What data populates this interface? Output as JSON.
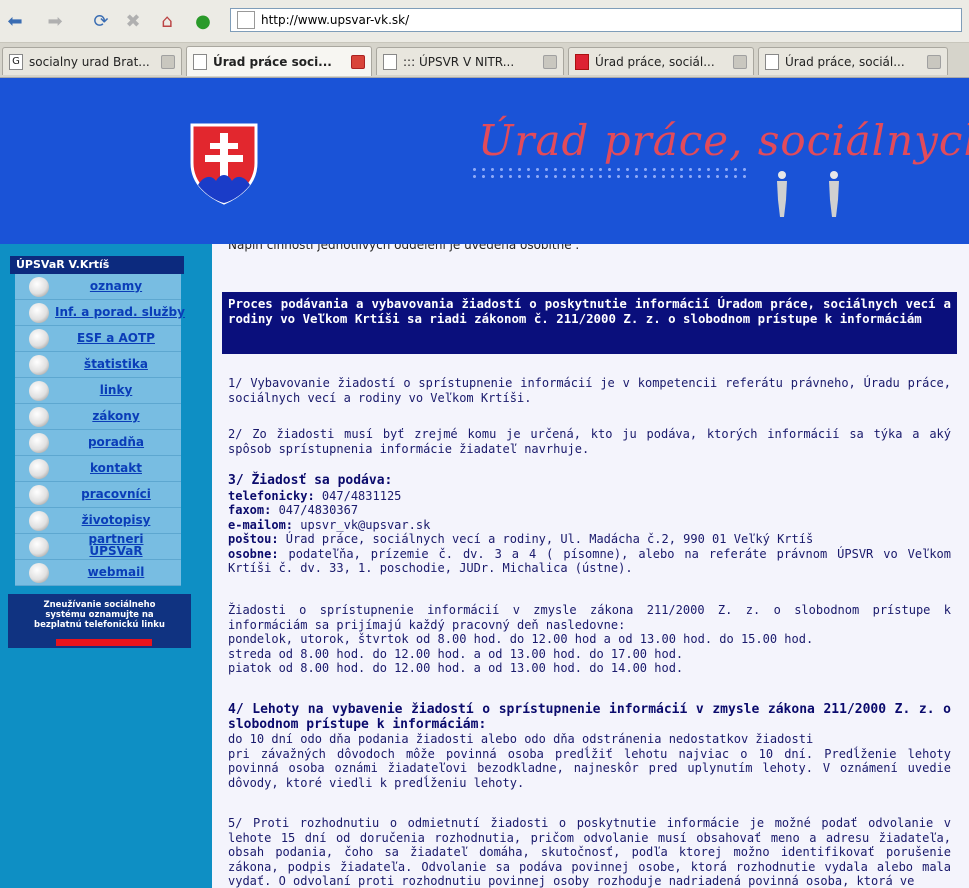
{
  "browser": {
    "address": "http://www.upsvar-vk.sk/",
    "tabs": [
      {
        "label": "socialny urad Brat...",
        "icon": "google-icon",
        "active": false
      },
      {
        "label": "Úrad práce soci...",
        "icon": "page-icon",
        "active": true
      },
      {
        "label": "::: ÚPSVR V NITR...",
        "icon": "page-icon",
        "active": false
      },
      {
        "label": "Úrad práce, sociál...",
        "icon": "crest-icon",
        "active": false
      },
      {
        "label": "Úrad práce, sociál...",
        "icon": "page-icon",
        "active": false
      }
    ]
  },
  "banner": {
    "title": "Úrad práce, sociálnych v"
  },
  "sidebar": {
    "heading": "ÚPSVaR V.Krtíš",
    "items": [
      {
        "label": "oznamy"
      },
      {
        "label": "Inf. a porad. služby"
      },
      {
        "label": "ESF a AOTP"
      },
      {
        "label": "štatistika"
      },
      {
        "label": "linky"
      },
      {
        "label": "zákony"
      },
      {
        "label": "poradňa"
      },
      {
        "label": "kontakt"
      },
      {
        "label": "pracovníci"
      },
      {
        "label": "životopisy"
      },
      {
        "label": "partneri ÚPSVaR"
      },
      {
        "label": "webmail"
      }
    ],
    "alert": {
      "line1": "Zneužívanie sociálneho",
      "line2": "systému oznamujte na",
      "line3": "bezplatnú telefonickú linku"
    }
  },
  "content": {
    "cut_line": "Náplň činnosti jednotlivých oddelení je uvedená osobitne .",
    "box_heading": "Proces podávania a vybavovania žiadostí o poskytnutie informácií Úradom práce, sociálnych vecí a rodiny vo Veľkom Krtíši sa riadi zákonom č. 211/2000 Z. z. o slobodnom prístupe k informáciám",
    "p1": "1/ Vybavovanie žiadostí o sprístupnenie informácií je v kompetencii referátu právneho, Úradu práce, sociálnych vecí a rodiny vo Veľkom Krtíši.",
    "p2": "2/ Zo žiadosti musí byť zrejmé komu je určená, kto ju podáva, ktorých informácií sa týka a aký spôsob sprístupnenia informácie žiadateľ navrhuje.",
    "p3": {
      "heading": "3/ Žiadosť sa podáva:",
      "phone_label": "telefonicky:",
      "phone": " 047/4831125",
      "fax_label": "faxom:",
      "fax": " 047/4830367",
      "email_label": "e-mailom:",
      "email": " upsvr_vk@upsvar.sk",
      "post_label": "poštou:",
      "post": " Úrad práce, sociálnych vecí a rodiny, Ul. Madácha č.2, 990 01 Veľký Krtíš",
      "personal_label": "osobne:",
      "personal": " podateľňa, prízemie č. dv. 3 a 4 ( písomne), alebo na referáte právnom ÚPSVR vo Veľkom Krtíši č. dv. 33, 1. poschodie, JUDr. Michalica (ústne)."
    },
    "hours": {
      "intro": "Žiadosti o sprístupnenie informácií v zmysle zákona 211/2000 Z. z. o slobodnom prístupe k informáciám sa prijímajú každý pracovný deň nasledovne:",
      "l1": "pondelok, utorok, štvrtok od 8.00 hod. do 12.00 hod a od 13.00 hod. do 15.00 hod.",
      "l2": "streda od 8.00 hod. do 12.00 hod. a od 13.00 hod. do 17.00 hod.",
      "l3": "piatok od 8.00 hod. do 12.00 hod. a od 13.00 hod. do 14.00 hod."
    },
    "p4": {
      "heading": "4/ Lehoty na vybavenie žiadostí o sprístupnenie informácií v zmysle zákona 211/2000 Z. z. o slobodnom prístupe k informáciám:",
      "l1": "do 10 dní odo dňa podania žiadosti alebo odo dňa odstránenia nedostatkov žiadosti",
      "l2": "pri závažných dôvodoch môže povinná osoba predĺžiť lehotu najviac o 10 dní. Predĺženie lehoty povinná osoba oznámi žiadateľovi bezodkladne, najneskôr pred uplynutím lehoty. V oznámení uvedie dôvody, ktoré viedli k predĺženiu lehoty."
    },
    "p5": "5/ Proti rozhodnutiu o odmietnutí žiadosti o poskytnutie informácie je možné podať odvolanie v lehote 15 dní od doručenia rozhodnutia, pričom odvolanie musí obsahovať meno a adresu žiadateľa, obsah podania, čoho sa žiadateľ domáha, skutočnosť, podľa ktorej možno identifikovať porušenie zákona, podpis žiadateľa. Odvolanie sa podáva povinnej osobe, ktorá rozhodnutie vydala alebo mala vydať. O odvolaní proti rozhodnutiu povinnej osoby rozhoduje nadriadená povinná osoba, ktorá ve"
  }
}
